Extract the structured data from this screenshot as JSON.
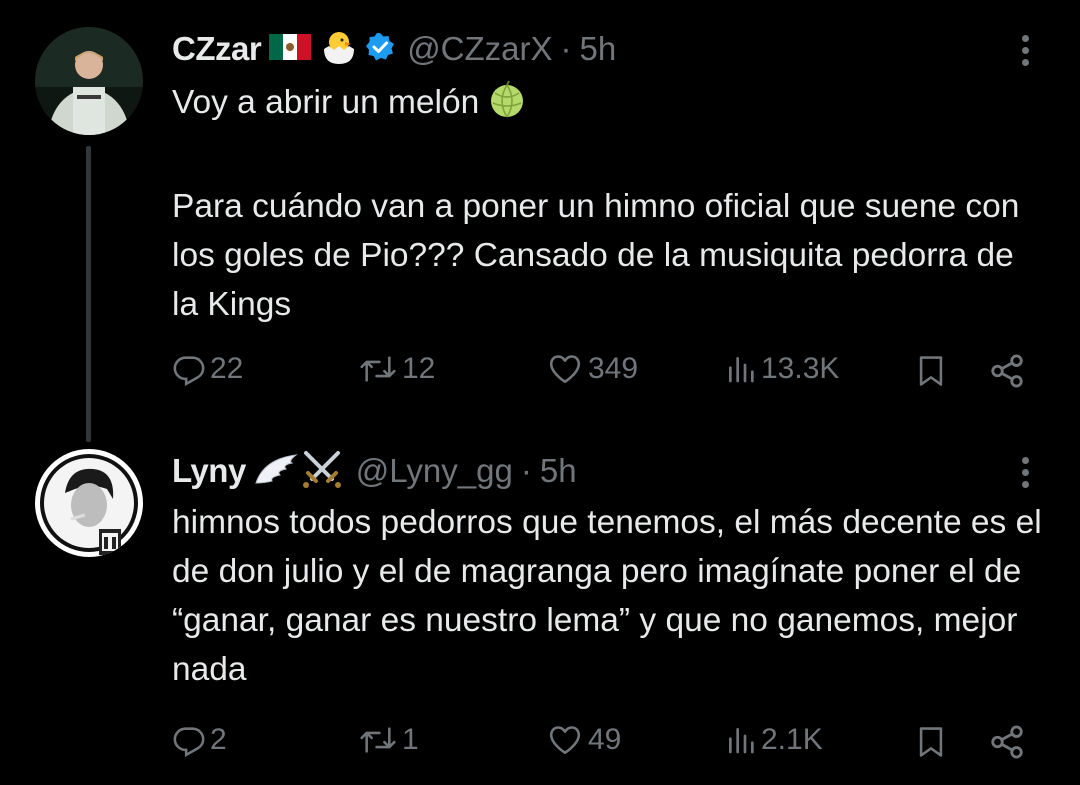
{
  "tweets": [
    {
      "author": {
        "name": "CZzar",
        "handle": "@CZzarX",
        "time": "5h",
        "verified": true
      },
      "paragraphs": [
        "Voy a abrir un melón",
        "Para cuándo van a poner un himno oficial que suene con los goles de Pio??? Cansado de la musiquita pedorra de la Kings"
      ],
      "stats": {
        "replies": "22",
        "reposts": "12",
        "likes": "349",
        "views": "13.3K"
      }
    },
    {
      "author": {
        "name": "Lyny",
        "handle": "@Lyny_gg",
        "time": "5h"
      },
      "paragraphs": [
        "himnos todos pedorros que tenemos, el más decente es el de don julio y el de magranga pero imagínate poner el de “ganar, ganar es nuestro lema” y que no ganemos, mejor nada"
      ],
      "stats": {
        "replies": "2",
        "reposts": "1",
        "likes": "49",
        "views": "2.1K"
      }
    }
  ],
  "separator": "·",
  "colors": {
    "background": "#000000",
    "text": "#e7e9ea",
    "muted": "#71767b",
    "verified": "#1d9bf0"
  }
}
